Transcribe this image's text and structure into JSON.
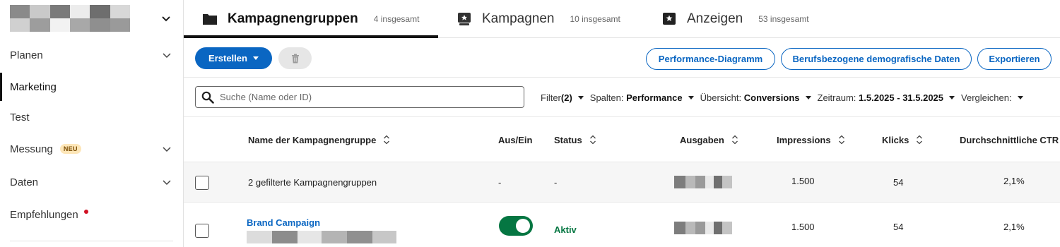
{
  "sidebar": {
    "items": [
      {
        "label": "Planen"
      },
      {
        "label": "Marketing"
      },
      {
        "label": "Test"
      },
      {
        "label": "Messung",
        "badge": "NEU"
      },
      {
        "label": "Daten"
      },
      {
        "label": "Empfehlungen"
      }
    ]
  },
  "tabs": [
    {
      "label": "Kampagnengruppen",
      "count": "4 insgesamt",
      "icon": "folder-icon"
    },
    {
      "label": "Kampagnen",
      "count": "10 insgesamt",
      "icon": "campaign-icon"
    },
    {
      "label": "Anzeigen",
      "count": "53 insgesamt",
      "icon": "ad-icon"
    }
  ],
  "toolbar": {
    "create_label": "Erstellen",
    "performance_label": "Performance-Diagramm",
    "demographics_label": "Berufsbezogene demografische Daten",
    "export_label": "Exportieren"
  },
  "filters": {
    "search_placeholder": "Suche (Name oder ID)",
    "filter_label": "Filter",
    "filter_count": "(2)",
    "columns_label": "Spalten:",
    "columns_value": "Performance",
    "overview_label": "Übersicht:",
    "overview_value": "Conversions",
    "period_label": "Zeitraum:",
    "period_value": "1.5.2025 - 31.5.2025",
    "compare_label": "Vergleichen:"
  },
  "table": {
    "headers": {
      "name": "Name der Kampagnengruppe",
      "toggle": "Aus/Ein",
      "status": "Status",
      "spend": "Ausgaben",
      "impressions": "Impressions",
      "clicks": "Klicks",
      "ctr": "Durchschnittliche CTR"
    },
    "summary": {
      "name": "2 gefilterte Kampagnengruppen",
      "toggle": "-",
      "status": "-",
      "impressions": "1.500",
      "clicks": "54",
      "ctr": "2,1%"
    },
    "rows": [
      {
        "name": "Brand Campaign",
        "status": "Aktiv",
        "toggle_on": true,
        "impressions": "1.500",
        "clicks": "54",
        "ctr": "2,1%"
      }
    ]
  },
  "colors": {
    "primary": "#0a66c2",
    "active_green": "#057642",
    "notify_red": "#d11124"
  }
}
